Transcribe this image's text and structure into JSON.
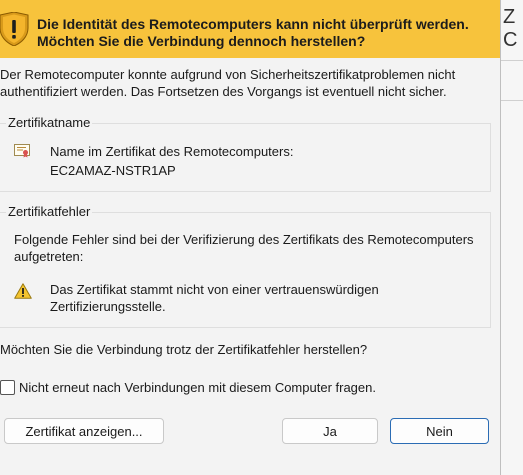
{
  "dialog": {
    "banner_title": "Die Identität des Remotecomputers kann nicht überprüft werden. Möchten Sie die Verbindung dennoch herstellen?",
    "intro_text": "Der Remotecomputer konnte aufgrund von Sicherheitszertifikatproblemen nicht authentifiziert werden. Das Fortsetzen des Vorgangs ist eventuell nicht sicher.",
    "cert_name_group": {
      "label": "Zertifikatname",
      "name_label": "Name im Zertifikat des Remotecomputers:",
      "name_value": "EC2AMAZ-NSTR1AP"
    },
    "cert_error_group": {
      "label": "Zertifikatfehler",
      "intro": "Folgende Fehler sind bei der Verifizierung des Zertifikats des Remotecomputers aufgetreten:",
      "error": "Das Zertifikat stammt nicht von einer vertrauenswürdigen Zertifizierungsstelle."
    },
    "question": "Möchten Sie die Verbindung trotz der Zertifikatfehler herstellen?",
    "checkbox_label": "Nicht erneut nach Verbindungen mit diesem Computer fragen.",
    "checkbox_checked": false,
    "buttons": {
      "view_certificate": "Zertifikat anzeigen...",
      "yes": "Ja",
      "no": "Nein"
    }
  },
  "background": {
    "partial_glyph": "Z C"
  },
  "colors": {
    "banner": "#f7c33c",
    "default_button_border": "#2b6cb4"
  },
  "icons": {
    "banner": "security-shield-warning-icon",
    "certificate": "certificate-icon",
    "error": "warning-triangle-icon"
  }
}
